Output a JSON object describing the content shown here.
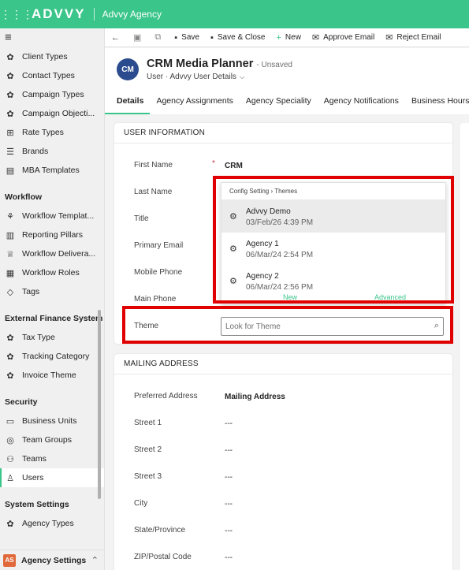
{
  "topbar": {
    "logo": "ADVVY",
    "org_name": "Advvy Agency"
  },
  "sidebar": {
    "items_top": [
      {
        "label": "Client Types",
        "icon": "gear-icon"
      },
      {
        "label": "Contact Types",
        "icon": "gear-icon"
      },
      {
        "label": "Campaign Types",
        "icon": "gear-icon"
      },
      {
        "label": "Campaign Objecti...",
        "icon": "gear-icon"
      },
      {
        "label": "Rate Types",
        "icon": "grid-icon"
      },
      {
        "label": "Brands",
        "icon": "stack-icon"
      },
      {
        "label": "MBA Templates",
        "icon": "document-icon"
      }
    ],
    "groups": {
      "workflow": "Workflow",
      "external_finance": "External Finance System",
      "security": "Security",
      "system_settings": "System Settings"
    },
    "workflow_items": [
      {
        "label": "Workflow Templat...",
        "icon": "flow-icon"
      },
      {
        "label": "Reporting Pillars",
        "icon": "pillars-icon"
      },
      {
        "label": "Workflow Delivera...",
        "icon": "trophy-icon"
      },
      {
        "label": "Workflow Roles",
        "icon": "roles-icon"
      },
      {
        "label": "Tags",
        "icon": "tag-icon"
      }
    ],
    "finance_items": [
      {
        "label": "Tax Type",
        "icon": "gear-icon"
      },
      {
        "label": "Tracking Category",
        "icon": "gear-icon"
      },
      {
        "label": "Invoice Theme",
        "icon": "gear-icon"
      }
    ],
    "security_items": [
      {
        "label": "Business Units",
        "icon": "business-icon"
      },
      {
        "label": "Team Groups",
        "icon": "team-groups-icon"
      },
      {
        "label": "Teams",
        "icon": "teams-icon"
      },
      {
        "label": "Users",
        "icon": "user-icon"
      }
    ],
    "system_items": [
      {
        "label": "Agency Types",
        "icon": "gear-icon"
      }
    ],
    "area": {
      "badge": "AS",
      "label": "Agency Settings"
    }
  },
  "commands": {
    "save": "Save",
    "save_close": "Save & Close",
    "new": "New",
    "approve_email": "Approve Email",
    "reject_email": "Reject Email"
  },
  "record": {
    "avatar": "CM",
    "title": "CRM Media Planner",
    "status": "- Unsaved",
    "entity": "User",
    "form": "Advvy User Details"
  },
  "tabs": [
    "Details",
    "Agency Assignments",
    "Agency Speciality",
    "Agency Notifications",
    "Business Hours"
  ],
  "user_info": {
    "title": "USER INFORMATION",
    "first_name_label": "First Name",
    "first_name_value": "CRM",
    "last_name_label": "Last Name",
    "title_label": "Title",
    "primary_email_label": "Primary Email",
    "mobile_phone_label": "Mobile Phone",
    "main_phone_label": "Main Phone",
    "theme_label": "Theme",
    "theme_placeholder": "Look for Theme"
  },
  "lookup_dropdown": {
    "header": "Config Setting › Themes",
    "items": [
      {
        "name": "Advvy Demo",
        "date": "03/Feb/26 4:39 PM"
      },
      {
        "name": "Agency 1",
        "date": "06/Mar/24 2:54 PM"
      },
      {
        "name": "Agency 2",
        "date": "06/Mar/24 2:56 PM"
      }
    ],
    "footer_new": "New",
    "footer_advanced": "Advanced"
  },
  "mailing": {
    "title": "MAILING ADDRESS",
    "preferred_label": "Preferred Address",
    "preferred_value": "Mailing Address",
    "street1_label": "Street 1",
    "street1_value": "---",
    "street2_label": "Street 2",
    "street2_value": "---",
    "street3_label": "Street 3",
    "street3_value": "---",
    "city_label": "City",
    "city_value": "---",
    "state_label": "State/Province",
    "state_value": "---",
    "zip_label": "ZIP/Postal Code",
    "zip_value": "---"
  },
  "colors": {
    "accent": "#3ac58a",
    "highlight_box": "#e00000",
    "avatar": "#2a4b8d",
    "area_badge": "#e0683a"
  }
}
